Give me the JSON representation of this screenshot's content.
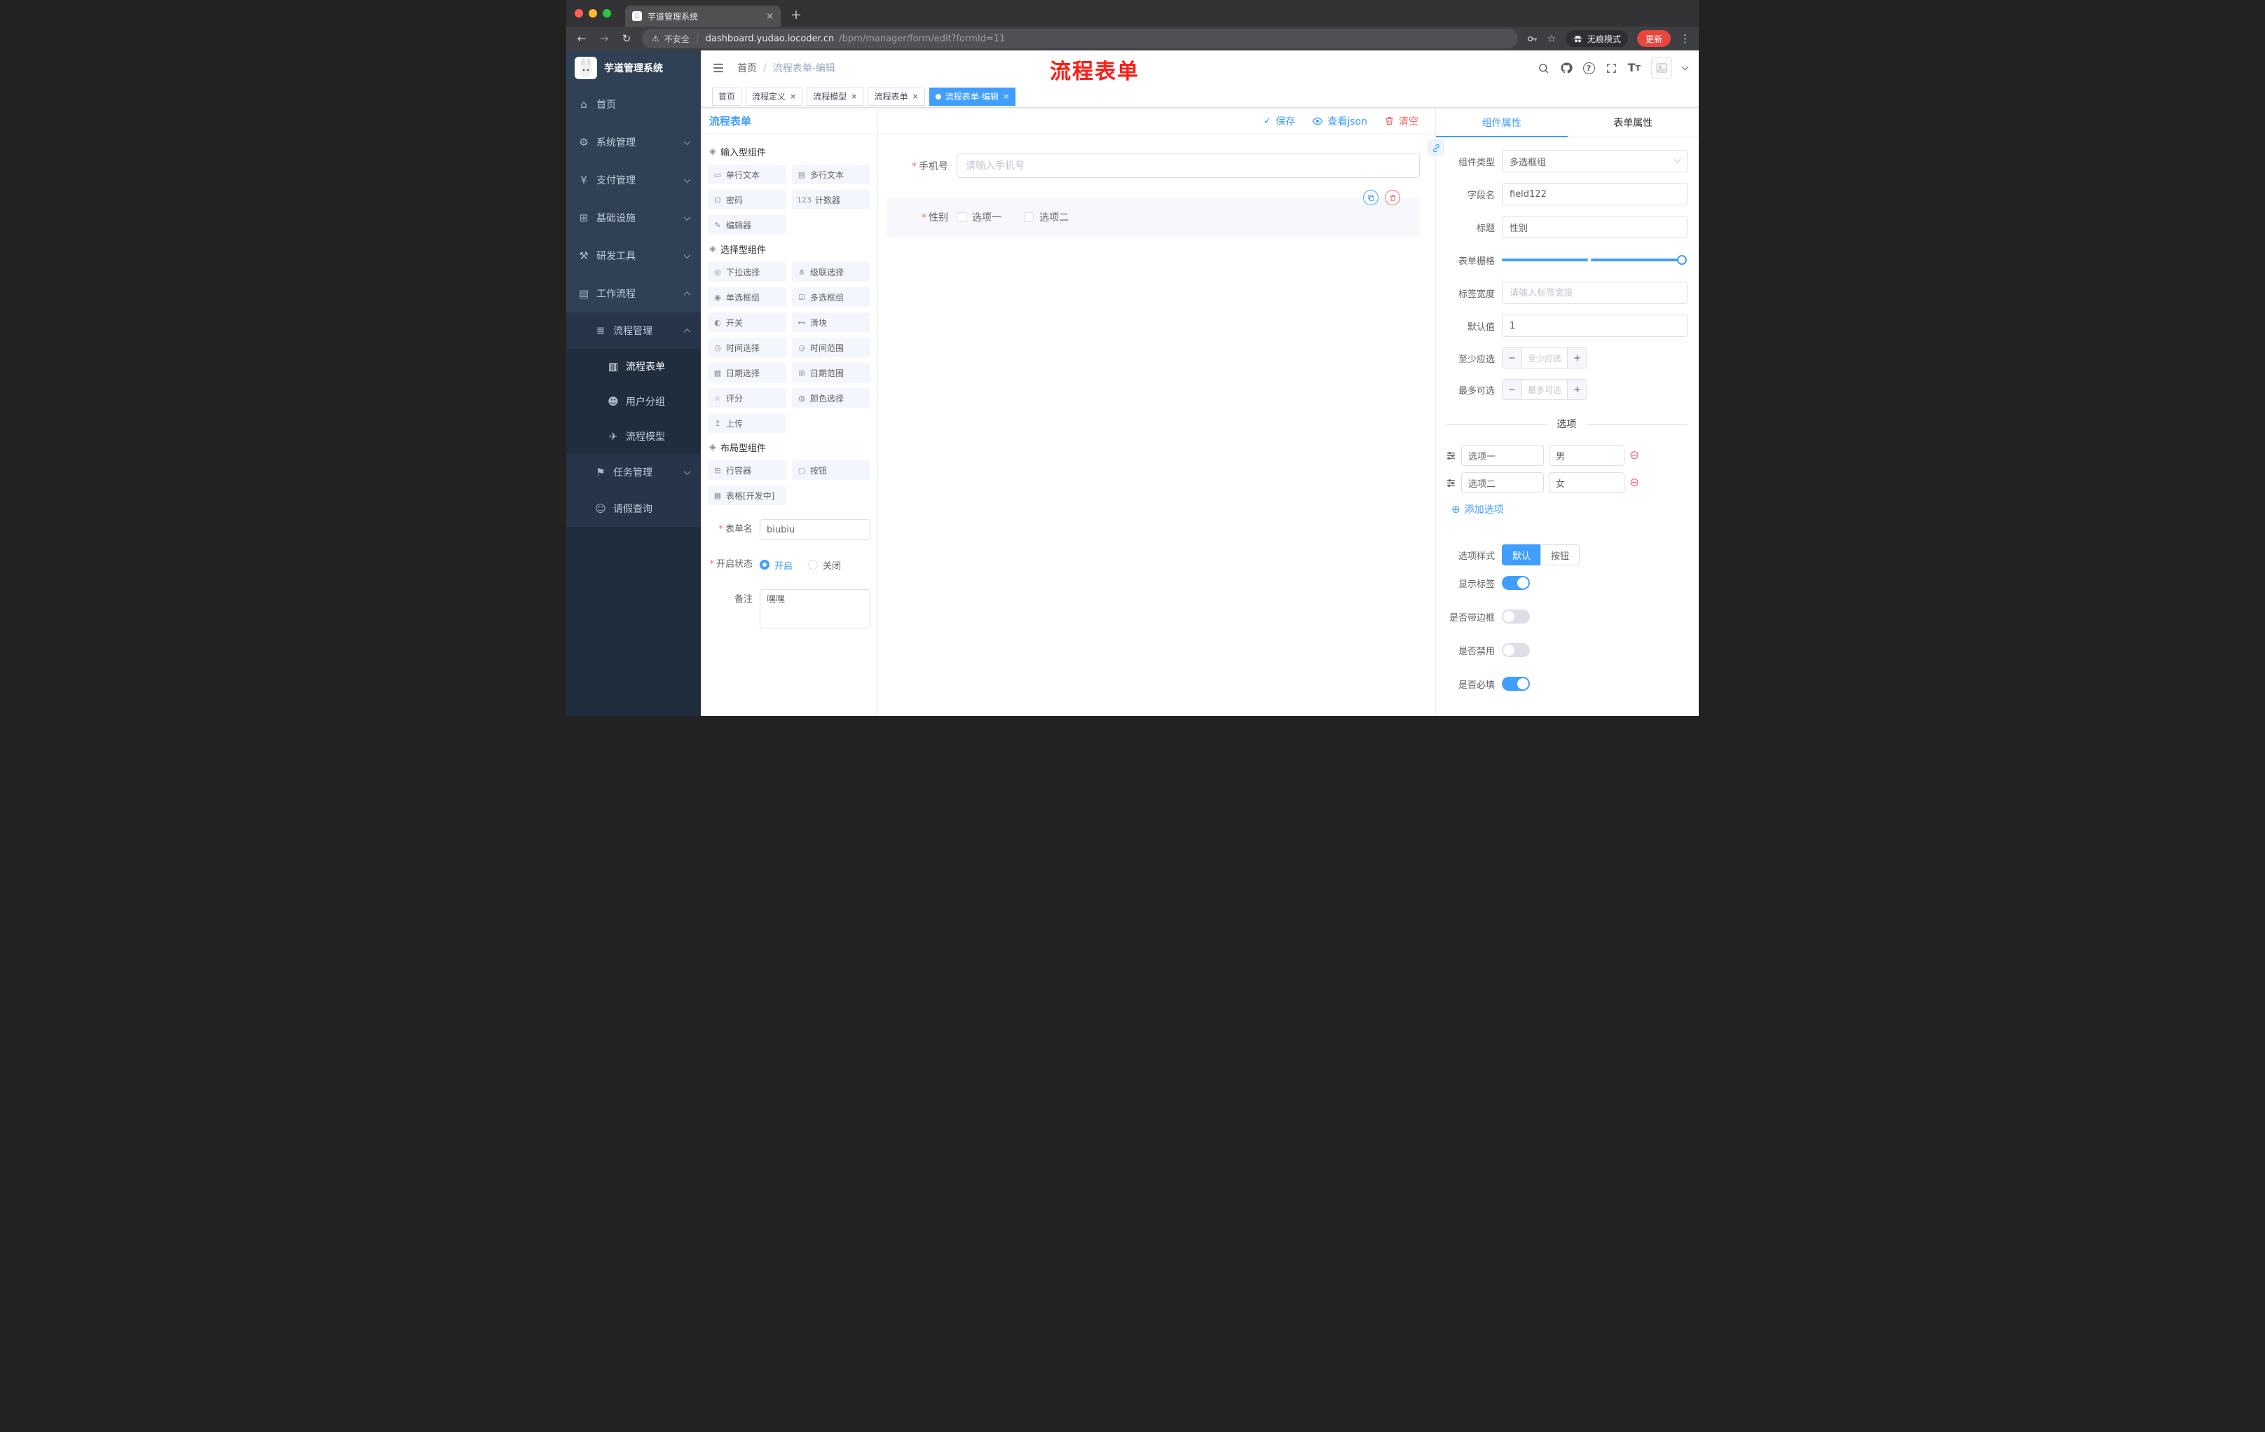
{
  "glyphs": {
    "close": "×",
    "plus": "+",
    "kebab": "⋮",
    "back": "←",
    "forward": "→",
    "reload": "↻",
    "warning": "⚠",
    "star": "☆",
    "check": "✓",
    "minus": "−",
    "add_circle": "⊕",
    "remove_circle": "⊖",
    "text_size_big": "T",
    "text_size_small": "T",
    "question": "?"
  },
  "browser": {
    "tab_title": "芋道管理系统",
    "security_label": "不安全",
    "url_host": "dashboard.yudao.iocoder.cn",
    "url_path": "/bpm/manager/form/edit?formId=11",
    "incognito_label": "无痕模式",
    "update_label": "更新"
  },
  "annotation": {
    "text": "流程表单",
    "color": "#fe1c14"
  },
  "sidebar": {
    "app_title": "芋道管理系统",
    "items": [
      {
        "label": "首页",
        "glyph": "⌂"
      },
      {
        "label": "系统管理",
        "glyph": "⚙"
      },
      {
        "label": "支付管理",
        "glyph": "¥"
      },
      {
        "label": "基础设施",
        "glyph": "⊞"
      },
      {
        "label": "研发工具",
        "glyph": "⚒"
      },
      {
        "label": "工作流程",
        "glyph": "▤"
      },
      {
        "label": "流程管理",
        "glyph": "≣"
      },
      {
        "label": "流程表单",
        "glyph": "▥"
      },
      {
        "label": "用户分组",
        "glyph": "☻"
      },
      {
        "label": "流程模型",
        "glyph": "✈"
      },
      {
        "label": "任务管理",
        "glyph": "⚑"
      },
      {
        "label": "请假查询",
        "glyph": "☺"
      }
    ]
  },
  "header": {
    "breadcrumb_home": "首页",
    "breadcrumb_sep": "/",
    "breadcrumb_current": "流程表单-编辑"
  },
  "tags": [
    {
      "label": "首页"
    },
    {
      "label": "流程定义"
    },
    {
      "label": "流程模型"
    },
    {
      "label": "流程表单"
    },
    {
      "label": "流程表单-编辑"
    }
  ],
  "palette": {
    "title": "流程表单",
    "sections": [
      {
        "title": "输入型组件",
        "icon_glyph": "◈",
        "items": [
          {
            "label": "单行文本",
            "glyph": "▭",
            "name": "palette-item-single-line-text",
            "icon_name": "single-line-text-icon"
          },
          {
            "label": "多行文本",
            "glyph": "▤",
            "name": "palette-item-textarea",
            "icon_name": "textarea-icon"
          },
          {
            "label": "密码",
            "glyph": "⊡",
            "name": "palette-item-password",
            "icon_name": "password-icon"
          },
          {
            "label": "计数器",
            "glyph": "123",
            "name": "palette-item-counter",
            "icon_name": "counter-icon"
          },
          {
            "label": "编辑器",
            "glyph": "✎",
            "name": "palette-item-editor",
            "icon_name": "editor-icon"
          }
        ]
      },
      {
        "title": "选择型组件",
        "icon_glyph": "◈",
        "items": [
          {
            "label": "下拉选择",
            "glyph": "◎",
            "name": "palette-item-select",
            "icon_name": "select-icon"
          },
          {
            "label": "级联选择",
            "glyph": "⋔",
            "name": "palette-item-cascader",
            "icon_name": "cascader-icon"
          },
          {
            "label": "单选框组",
            "glyph": "◉",
            "name": "palette-item-radio-group",
            "icon_name": "radio-group-icon"
          },
          {
            "label": "多选框组",
            "glyph": "☑",
            "name": "palette-item-checkbox-group",
            "icon_name": "checkbox-group-icon"
          },
          {
            "label": "开关",
            "glyph": "◐",
            "name": "palette-item-switch",
            "icon_name": "switch-icon"
          },
          {
            "label": "滑块",
            "glyph": "⊷",
            "name": "palette-item-slider",
            "icon_name": "slider-icon"
          },
          {
            "label": "时间选择",
            "glyph": "◷",
            "name": "palette-item-time-picker",
            "icon_name": "time-picker-icon"
          },
          {
            "label": "时间范围",
            "glyph": "◶",
            "name": "palette-item-time-range",
            "icon_name": "time-range-icon"
          },
          {
            "label": "日期选择",
            "glyph": "▦",
            "name": "palette-item-date-picker",
            "icon_name": "date-picker-icon"
          },
          {
            "label": "日期范围",
            "glyph": "⊞",
            "name": "palette-item-date-range",
            "icon_name": "date-range-icon"
          },
          {
            "label": "评分",
            "glyph": "☆",
            "name": "palette-item-rate",
            "icon_name": "rate-icon"
          },
          {
            "label": "颜色选择",
            "glyph": "◍",
            "name": "palette-item-color-picker",
            "icon_name": "color-picker-icon"
          },
          {
            "label": "上传",
            "glyph": "↥",
            "name": "palette-item-upload",
            "icon_name": "upload-icon"
          }
        ]
      },
      {
        "title": "布局型组件",
        "icon_glyph": "◈",
        "items": [
          {
            "label": "行容器",
            "glyph": "⊟",
            "name": "palette-item-row-container",
            "icon_name": "row-container-icon"
          },
          {
            "label": "按钮",
            "glyph": "▢",
            "name": "palette-item-button",
            "icon_name": "button-icon"
          },
          {
            "label": "表格[开发中]",
            "glyph": "▦",
            "name": "palette-item-table",
            "icon_name": "table-icon"
          }
        ]
      }
    ]
  },
  "form_settings": {
    "form_name_label": "表单名",
    "form_name_value": "biubiu",
    "status_label": "开启状态",
    "status_on": "开启",
    "status_off": "关闭",
    "remark_label": "备注",
    "remark_value": "嘿嘿"
  },
  "canvas": {
    "toolbar": {
      "save": "保存",
      "view_json": "查看json",
      "clear": "清空"
    },
    "phone_field": {
      "label": "手机号",
      "placeholder": "请输入手机号"
    },
    "gender_field": {
      "label": "性别",
      "options": [
        "选项一",
        "选项二"
      ]
    }
  },
  "props": {
    "tabs": {
      "component": "组件属性",
      "form": "表单属性"
    },
    "component_type_label": "组件类型",
    "component_type_value": "多选框组",
    "field_name_label": "字段名",
    "field_name_value": "field122",
    "title_label": "标题",
    "title_value": "性别",
    "grid_label": "表单栅格",
    "label_width_label": "标签宽度",
    "label_width_placeholder": "请输入标签宽度",
    "default_label": "默认值",
    "default_value": "1",
    "min_label": "至少应选",
    "min_placeholder": "至少应选",
    "max_label": "最多可选",
    "max_placeholder": "最多可选",
    "options_divider": "选项",
    "options": [
      {
        "label": "选项一",
        "value": "男"
      },
      {
        "label": "选项二",
        "value": "女"
      }
    ],
    "add_option": "添加选项",
    "option_style_label": "选项样式",
    "option_style_default": "默认",
    "option_style_button": "按钮",
    "switches": [
      {
        "label": "显示标签",
        "on": true
      },
      {
        "label": "是否带边框",
        "on": false
      },
      {
        "label": "是否禁用",
        "on": false
      },
      {
        "label": "是否必填",
        "on": true
      }
    ]
  },
  "colors": {
    "accent": "#409eff",
    "danger": "#f56c6c",
    "sidebar": "#304156",
    "sidebar_dark": "#1f2d3d"
  }
}
